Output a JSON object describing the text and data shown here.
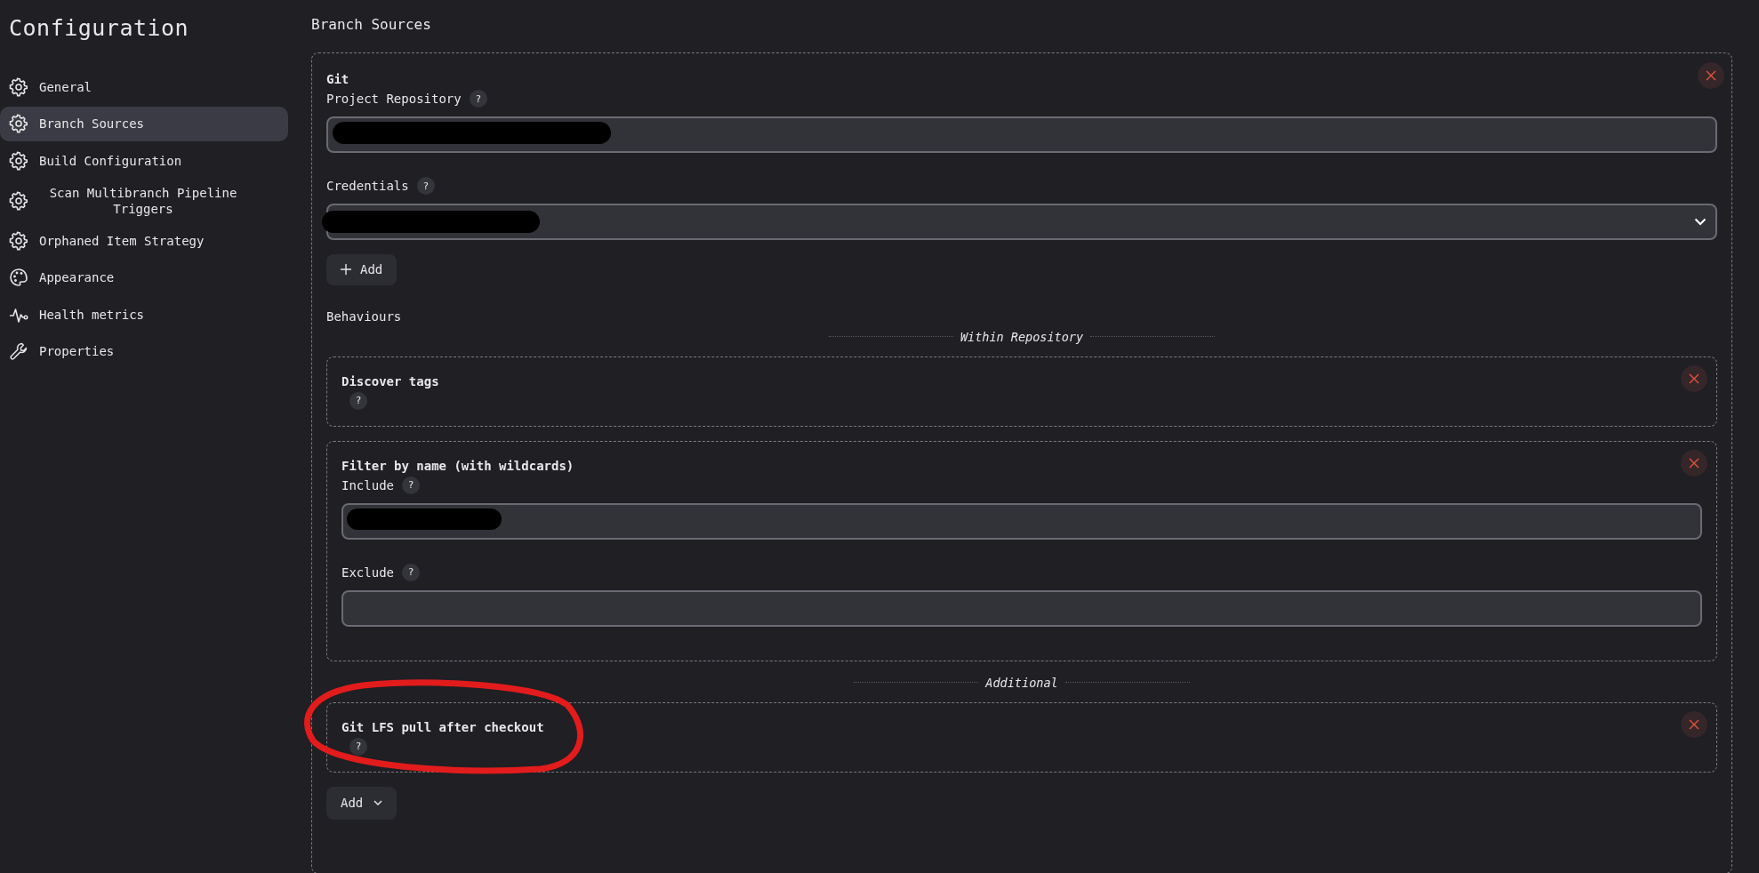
{
  "sidebar": {
    "title": "Configuration",
    "items": [
      {
        "label": "General",
        "selected": false
      },
      {
        "label": "Branch Sources",
        "selected": true
      },
      {
        "label": "Build Configuration",
        "selected": false
      },
      {
        "label": "Scan Multibranch Pipeline Triggers",
        "selected": false
      },
      {
        "label": "Orphaned Item Strategy",
        "selected": false
      },
      {
        "label": "Appearance",
        "selected": false
      },
      {
        "label": "Health metrics",
        "selected": false
      },
      {
        "label": "Properties",
        "selected": false
      }
    ]
  },
  "section": {
    "title": "Branch Sources",
    "source": {
      "title": "Git",
      "fields": [
        {
          "kind": "text",
          "label": "Project Repository",
          "help": "?",
          "redacted": true
        },
        {
          "kind": "select",
          "label": "Credentials",
          "help": "?",
          "redacted": true
        }
      ],
      "add_button": {
        "label": "Add"
      },
      "behaviours_label": "Behaviours",
      "groups": [
        {
          "heading": "Within Repository",
          "items": [
            {
              "title": "Discover tags",
              "help": "?"
            },
            {
              "title": "Filter by name (with wildcards)",
              "fields": [
                {
                  "kind": "text",
                  "label": "Include",
                  "help": "?",
                  "redacted": true
                },
                {
                  "kind": "text",
                  "label": "Exclude",
                  "help": "?"
                }
              ]
            }
          ]
        },
        {
          "heading": "Additional",
          "items": [
            {
              "title": "Git LFS pull after checkout",
              "help": "?",
              "circled": true
            }
          ]
        }
      ],
      "add_menu_button": {
        "label": "Add"
      }
    }
  }
}
